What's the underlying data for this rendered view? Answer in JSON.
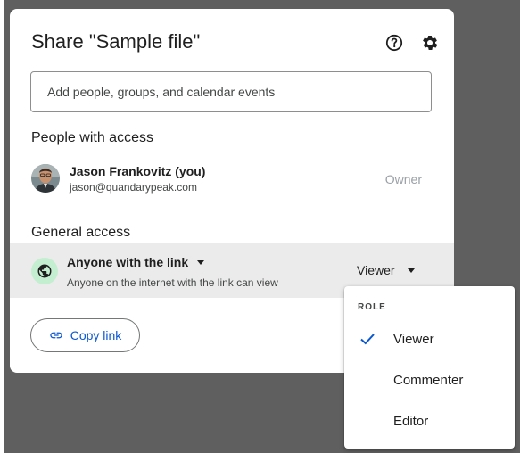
{
  "dialog": {
    "title": "Share \"Sample file\"",
    "add_people_placeholder": "Add people, groups, and calendar events",
    "help_icon": "help-circle-icon",
    "settings_icon": "gear-icon"
  },
  "people_section": {
    "heading": "People with access",
    "people": [
      {
        "name": "Jason Frankovitz (you)",
        "email": "jason@quandarypeak.com",
        "role": "Owner"
      }
    ]
  },
  "general_access": {
    "heading": "General access",
    "icon": "globe-icon",
    "access_level": "Anyone with the link",
    "description": "Anyone on the internet with the link can view",
    "role": "Viewer"
  },
  "copy_link": {
    "label": "Copy link",
    "icon": "link-icon",
    "accent": "#0b57d0"
  },
  "role_menu": {
    "header": "ROLE",
    "options": [
      {
        "label": "Viewer",
        "selected": true
      },
      {
        "label": "Commenter",
        "selected": false
      },
      {
        "label": "Editor",
        "selected": false
      }
    ],
    "check_color": "#0b57d0"
  },
  "colors": {
    "backdrop": "#5f5f5f",
    "access_row_bg": "#ebebeb",
    "globe_bg": "#c4eed0"
  }
}
